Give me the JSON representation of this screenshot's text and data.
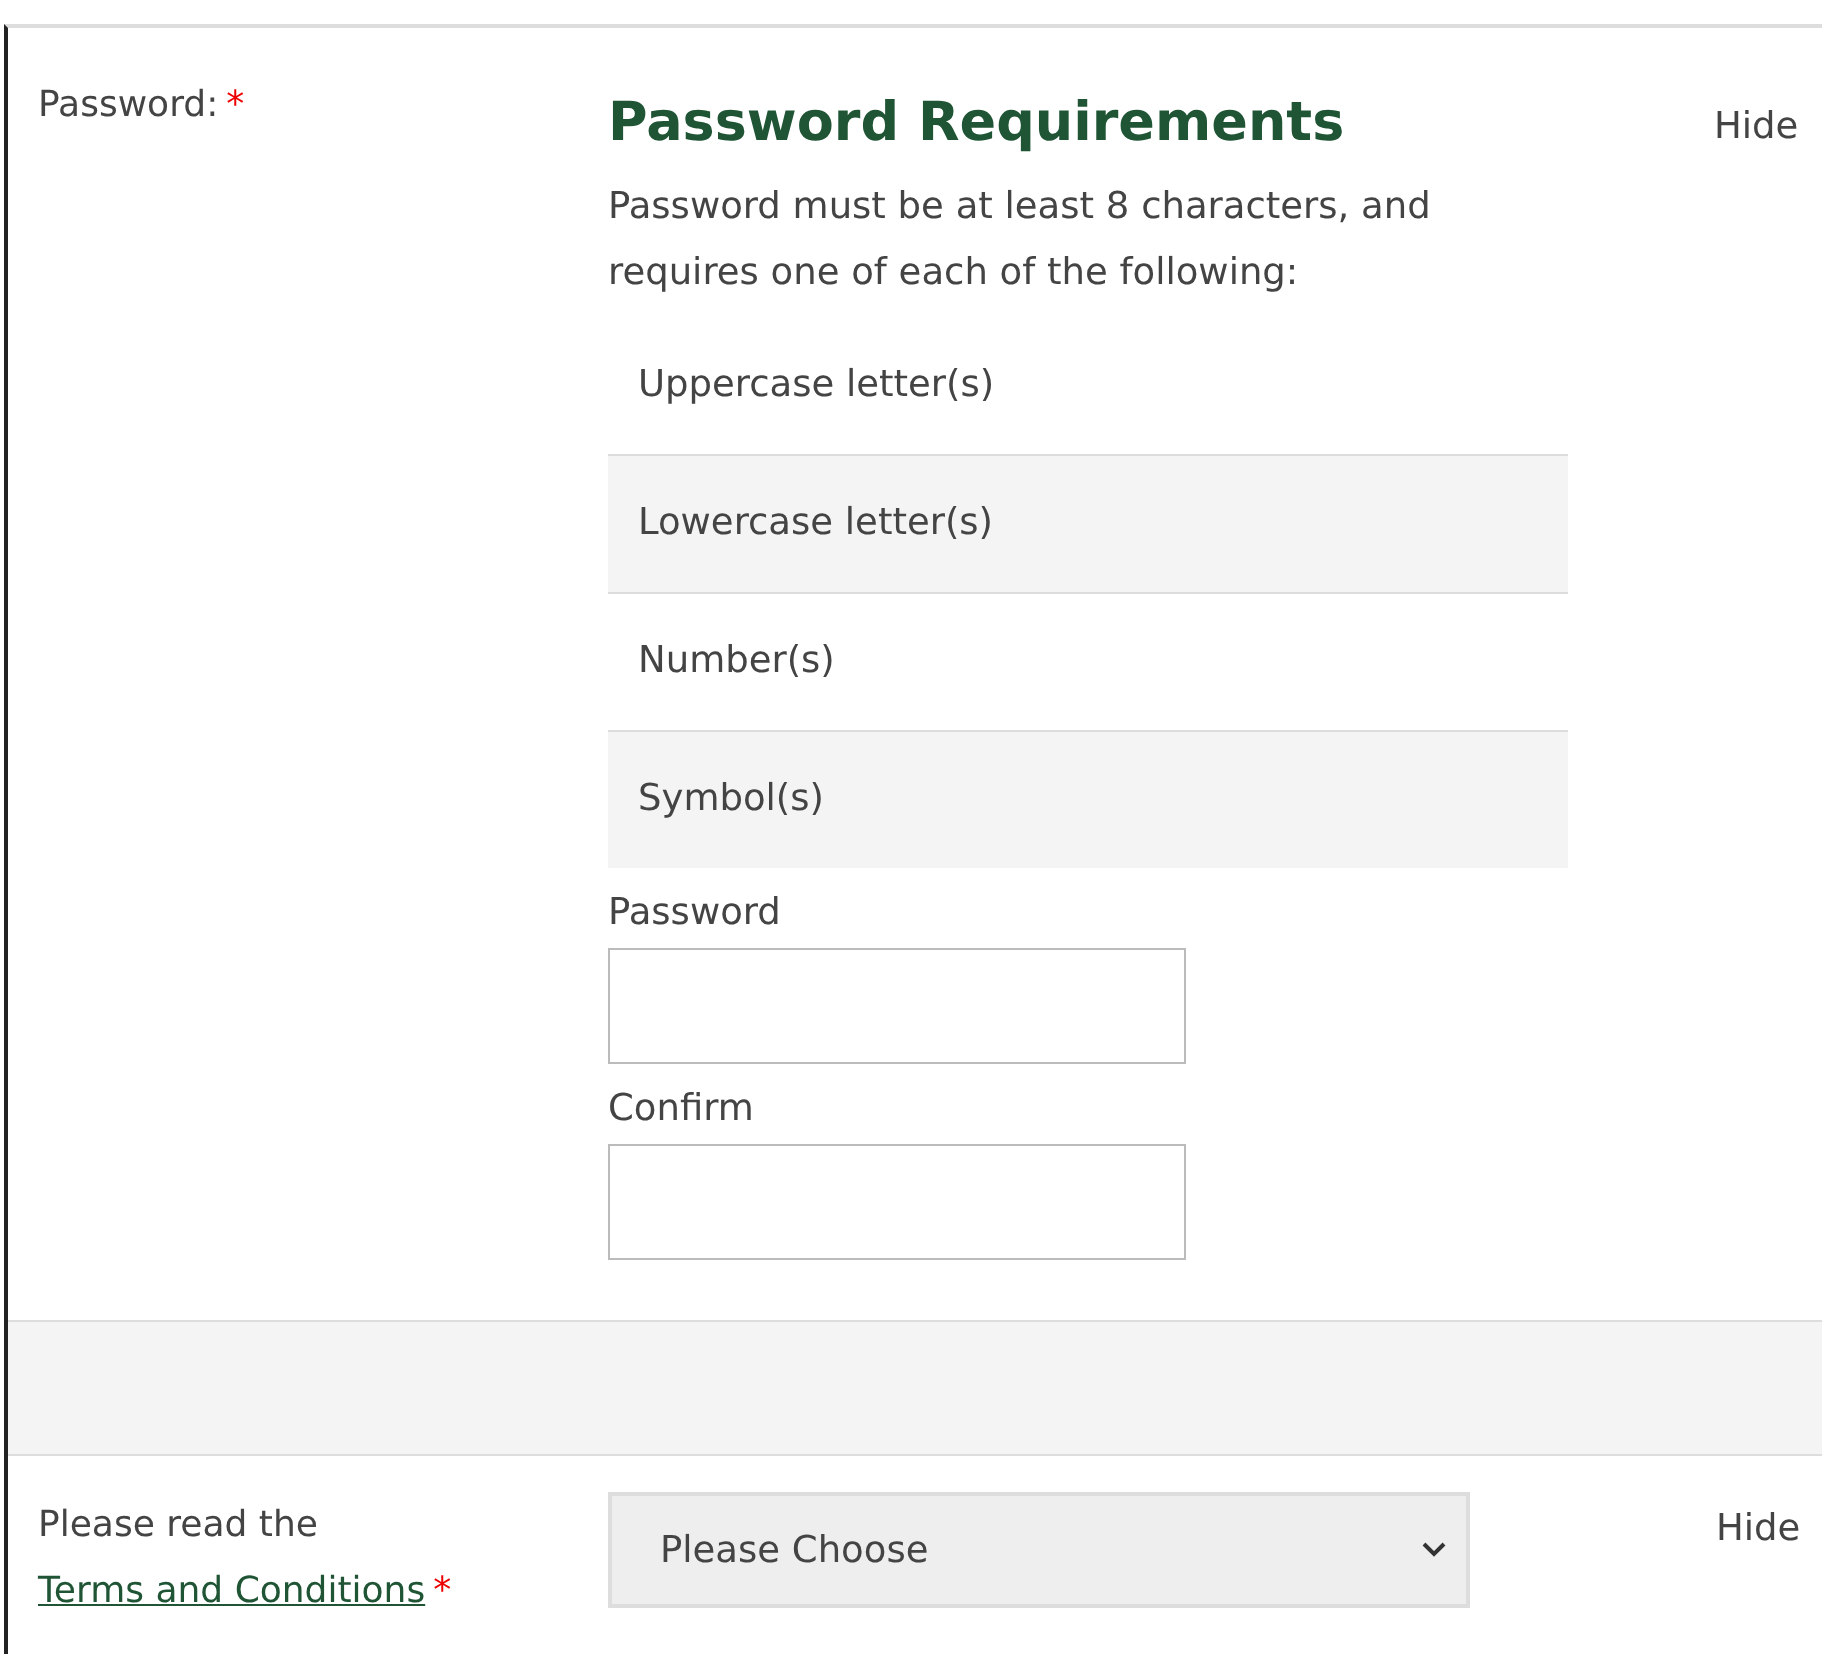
{
  "password_row": {
    "label": "Password:",
    "required_mark": "*",
    "hide_link": "Hide",
    "requirements": {
      "title": "Password Requirements",
      "intro": "Password must be at least 8 characters, and requires one of each of the following:",
      "items": [
        "Uppercase letter(s)",
        "Lowercase letter(s)",
        "Number(s)",
        "Symbol(s)"
      ]
    },
    "fields": [
      {
        "label": "Password"
      },
      {
        "label": "Confirm"
      }
    ]
  },
  "terms_row": {
    "label_text": "Please read the",
    "link": "Terms and Conditions",
    "required_mark": "*",
    "select": {
      "value": "Please Choose"
    },
    "hide_link": "Hide"
  }
}
